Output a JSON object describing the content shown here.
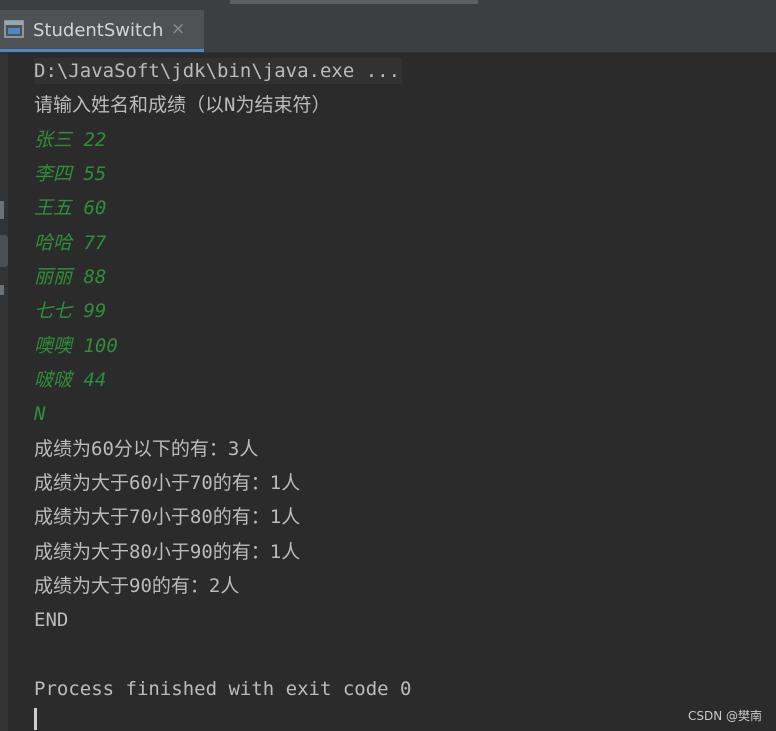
{
  "tab": {
    "title": "StudentSwitch",
    "close_symbol": "×"
  },
  "console": {
    "command": "D:\\JavaSoft\\jdk\\bin\\java.exe ...",
    "prompt": "请输入姓名和成绩（以N为结束符）",
    "inputs": [
      "张三 22",
      "李四 55",
      "王五 60",
      "哈哈 77",
      "丽丽 88",
      "七七 99",
      "噢噢 100",
      "啵啵 44",
      "N"
    ],
    "results": [
      "成绩为60分以下的有：3人",
      "成绩为大于60小于70的有：1人",
      "成绩为大于70小于80的有：1人",
      "成绩为大于80小于90的有：1人",
      "成绩为大于90的有：2人"
    ],
    "end": "END",
    "exit_message": "Process finished with exit code 0"
  },
  "watermark": "CSDN @樊南",
  "colors": {
    "background": "#2b2b2b",
    "input_text": "#2f8f39",
    "output_text": "#bbbbbb",
    "tab_accent": "#4a88c7"
  },
  "icons": {
    "tab": "console-window-icon"
  }
}
